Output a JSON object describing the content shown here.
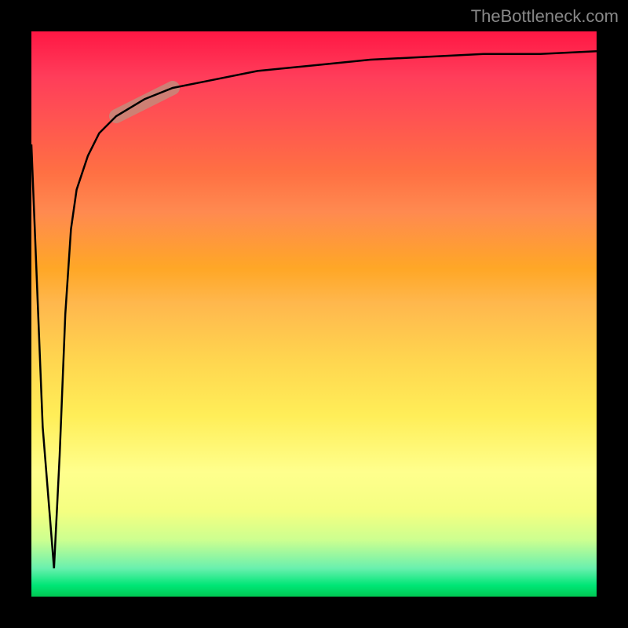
{
  "watermark": "TheBottleneck.com",
  "chart_data": {
    "type": "line",
    "title": "",
    "xlabel": "",
    "ylabel": "",
    "xlim": [
      0,
      100
    ],
    "ylim": [
      0,
      100
    ],
    "background_gradient": {
      "top_color": "#ff1744",
      "mid_color": "#ffd54f",
      "bottom_color": "#00c853",
      "description": "red-to-yellow-to-green vertical gradient"
    },
    "series": [
      {
        "name": "bottleneck-curve",
        "description": "V-shaped dip near x=0 then sharp rise to asymptote near top",
        "x": [
          0,
          2,
          4,
          5,
          6,
          7,
          8,
          10,
          12,
          15,
          20,
          25,
          30,
          40,
          50,
          60,
          70,
          80,
          90,
          100
        ],
        "values": [
          80,
          30,
          5,
          25,
          50,
          65,
          72,
          78,
          82,
          85,
          88,
          90,
          91,
          93,
          94,
          95,
          95.5,
          96,
          96,
          96.5
        ]
      }
    ],
    "highlight_region": {
      "x_start": 15,
      "x_end": 25,
      "description": "thick semi-transparent brown/rose segment on curve"
    }
  }
}
